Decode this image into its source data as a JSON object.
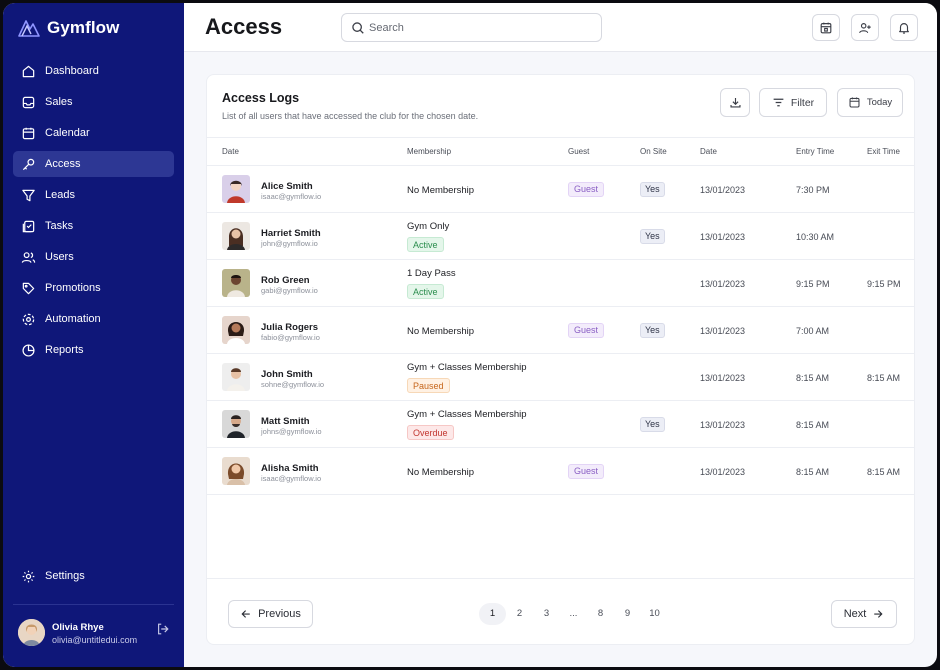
{
  "app": {
    "name": "Gymflow"
  },
  "sidebar": {
    "items": [
      {
        "label": "Dashboard",
        "icon": "home-icon"
      },
      {
        "label": "Sales",
        "icon": "inbox-icon"
      },
      {
        "label": "Calendar",
        "icon": "calendar-icon"
      },
      {
        "label": "Access",
        "icon": "key-icon",
        "active": true
      },
      {
        "label": "Leads",
        "icon": "filter-icon"
      },
      {
        "label": "Tasks",
        "icon": "tasks-icon"
      },
      {
        "label": "Users",
        "icon": "users-icon"
      },
      {
        "label": "Promotions",
        "icon": "tag-icon"
      },
      {
        "label": "Automation",
        "icon": "automation-icon"
      },
      {
        "label": "Reports",
        "icon": "pie-chart-icon"
      }
    ],
    "settings_label": "Settings",
    "user": {
      "name": "Olivia Rhye",
      "email": "olivia@untitledui.com"
    }
  },
  "header": {
    "title": "Access",
    "search_placeholder": "Search"
  },
  "card": {
    "title": "Access Logs",
    "subtitle": "List of all users that have accessed the club for the chosen date.",
    "filter_label": "Filter",
    "today_label": "Today"
  },
  "table": {
    "columns": [
      "Date",
      "Membership",
      "Guest",
      "On Site",
      "Date",
      "Entry Time",
      "Exit Time"
    ],
    "rows": [
      {
        "name": "Alice Smith",
        "email": "isaac@gymflow.io",
        "membership": "No Membership",
        "status": "",
        "guest": "Guest",
        "onsite": "Yes",
        "date": "13/01/2023",
        "entry": "7:30 PM",
        "exit": ""
      },
      {
        "name": "Harriet Smith",
        "email": "john@gymflow.io",
        "membership": "Gym Only",
        "status": "Active",
        "guest": "",
        "onsite": "Yes",
        "date": "13/01/2023",
        "entry": "10:30 AM",
        "exit": ""
      },
      {
        "name": "Rob Green",
        "email": "gabi@gymflow.io",
        "membership": "1 Day Pass",
        "status": "Active",
        "guest": "",
        "onsite": "",
        "date": "13/01/2023",
        "entry": "9:15 PM",
        "exit": "9:15 PM"
      },
      {
        "name": "Julia Rogers",
        "email": "fabio@gymflow.io",
        "membership": "No Membership",
        "status": "",
        "guest": "Guest",
        "onsite": "Yes",
        "date": "13/01/2023",
        "entry": "7:00 AM",
        "exit": ""
      },
      {
        "name": "John Smith",
        "email": "sohne@gymflow.io",
        "membership": "Gym + Classes Membership",
        "status": "Paused",
        "guest": "",
        "onsite": "",
        "date": "13/01/2023",
        "entry": "8:15 AM",
        "exit": "8:15 AM"
      },
      {
        "name": "Matt Smith",
        "email": "johns@gymflow.io",
        "membership": "Gym + Classes Membership",
        "status": "Overdue",
        "guest": "",
        "onsite": "Yes",
        "date": "13/01/2023",
        "entry": "8:15 AM",
        "exit": ""
      },
      {
        "name": "Alisha Smith",
        "email": "isaac@gymflow.io",
        "membership": "No Membership",
        "status": "",
        "guest": "Guest",
        "onsite": "",
        "date": "13/01/2023",
        "entry": "8:15 AM",
        "exit": "8:15 AM"
      }
    ]
  },
  "pagination": {
    "previous": "Previous",
    "next": "Next",
    "pages": [
      "1",
      "2",
      "3",
      "...",
      "8",
      "9",
      "10"
    ],
    "current": "1"
  },
  "colors": {
    "sidebar_bg": "#0f1779",
    "sidebar_active": "#2d3794",
    "active_green": "#2a8d4d",
    "paused_orange": "#c6661c",
    "overdue_red": "#c2362f",
    "guest_purple": "#8a5fc4"
  }
}
